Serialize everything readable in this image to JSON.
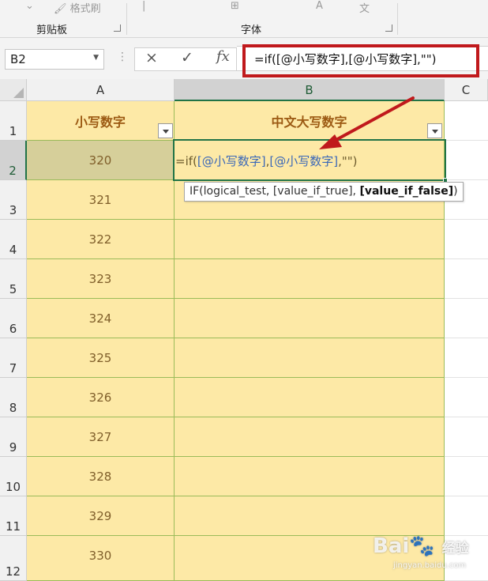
{
  "ribbon": {
    "format_painter_label": "格式刷",
    "clipboard_group_label": "剪贴板",
    "font_group_label": "字体"
  },
  "formula_bar": {
    "name_box": "B2",
    "cancel_icon": "×",
    "enter_icon": "✓",
    "function_icon": "fx",
    "formula": "=if([@小写数字],[@小写数字],\"\")"
  },
  "columns": [
    "A",
    "B",
    "C"
  ],
  "rows": [
    "1",
    "2",
    "3",
    "4",
    "5",
    "6",
    "7",
    "8",
    "9",
    "10",
    "11",
    "12"
  ],
  "table": {
    "header_a": "小写数字",
    "header_b": "中文大写数字",
    "values": [
      "320",
      "321",
      "322",
      "323",
      "324",
      "325",
      "326",
      "327",
      "328",
      "329",
      "330"
    ]
  },
  "editing": {
    "prefix": "=if(",
    "ref1": "[@小写数字]",
    "comma1": ",",
    "ref2": "[@小写数字]",
    "suffix": ",\"\")"
  },
  "tooltip": {
    "plain": "IF(logical_test, [value_if_true], ",
    "bold": "[value_if_false]",
    "end": ")"
  },
  "watermark": {
    "brand": "Bai",
    "brand2": "经验",
    "url": "jingyan.baidu.com"
  },
  "colors": {
    "accent": "#217346",
    "table_fill": "#fde9a6",
    "highlight_red": "#c0191c"
  }
}
